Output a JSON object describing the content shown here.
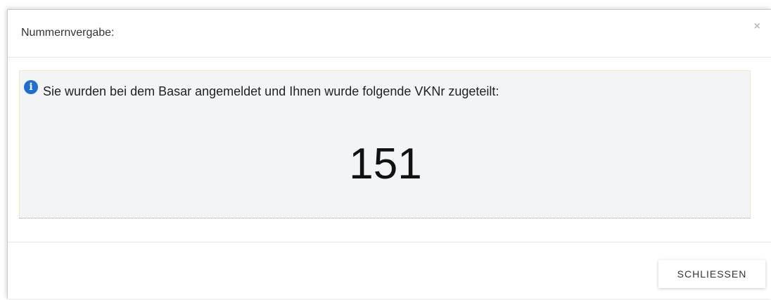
{
  "dialog": {
    "title": "Nummernvergabe:",
    "close_symbol": "×"
  },
  "info": {
    "icon": "info-icon",
    "icon_glyph": "i",
    "message": "Sie wurden bei dem Basar angemeldet und Ihnen wurde folgende VKNr zugeteilt:",
    "vk_number": "151"
  },
  "footer": {
    "close_label": "SCHLIESSEN"
  },
  "colors": {
    "info_icon": "#1f6fd1",
    "info_background": "#f3f4f6"
  }
}
